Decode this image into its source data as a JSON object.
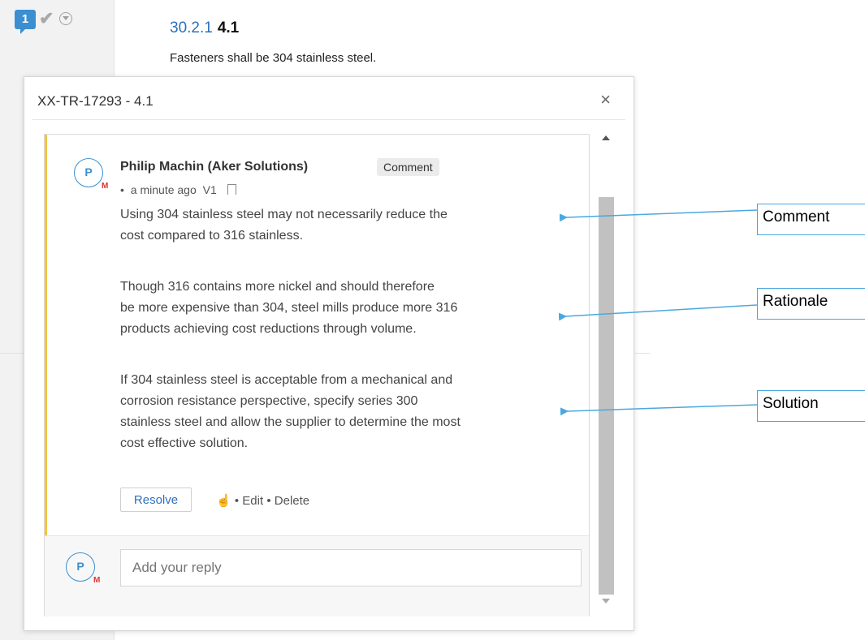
{
  "toolbar": {
    "comment_count": "1",
    "icons": {
      "check": "check-icon",
      "dropdown": "chevron-down-circle-icon"
    }
  },
  "clause": {
    "link": "30.2.1",
    "number": "4.1",
    "text": "Fasteners shall be 304 stainless steel."
  },
  "modal": {
    "title": "XX-TR-17293 - 4.1",
    "close": "×"
  },
  "comment": {
    "avatar_initial": "P",
    "avatar_badge": "M",
    "author": "Philip Machin (Aker Solutions)",
    "type": "Comment",
    "bullet": "•",
    "time": "a minute ago",
    "version": "V1",
    "paragraphs": [
      "Using 304 stainless steel may not necessarily reduce the\ncost compared to 316 stainless.",
      "Though 316 contains more nickel and should therefore\nbe more expensive than 304, steel mills produce more 316\nproducts achieving cost reductions through volume.",
      "If 304 stainless steel is acceptable from a mechanical and\ncorrosion resistance perspective, specify series 300\nstainless steel and allow the supplier to determine the most\ncost effective solution."
    ],
    "resolve_label": "Resolve",
    "like_glyph": "👍",
    "edit_label": "Edit",
    "delete_label": "Delete"
  },
  "reply": {
    "avatar_initial": "P",
    "avatar_badge": "M",
    "placeholder": "Add your reply"
  },
  "callouts": {
    "comment": "Comment",
    "rationale": "Rationale",
    "solution": "Solution"
  },
  "colors": {
    "accent": "#3b8fd1",
    "callout_border": "#4aa8e0",
    "comment_bar": "#f3c443"
  }
}
